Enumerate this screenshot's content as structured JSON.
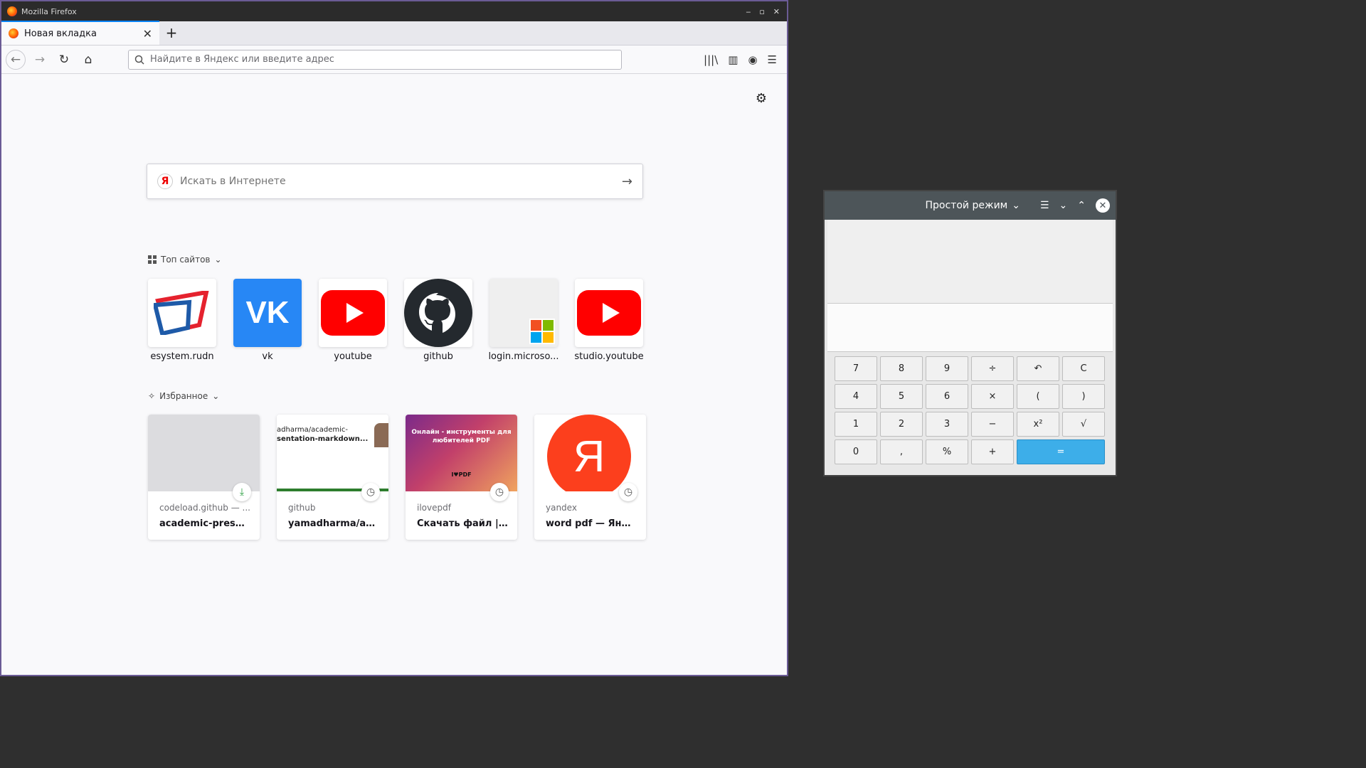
{
  "firefox": {
    "window_title": "Mozilla Firefox",
    "tab_title": "Новая вкладка",
    "url_placeholder": "Найдите в Яндекс или введите адрес",
    "search_placeholder": "Искать в Интернете",
    "top_sites_label": "Топ сайтов",
    "favorites_label": "Избранное",
    "top_sites": [
      {
        "label": "esystem.rudn",
        "icon": "esystem-logo"
      },
      {
        "label": "vk",
        "icon": "vk-logo",
        "color": "#2787f5"
      },
      {
        "label": "youtube",
        "icon": "youtube-logo",
        "color": "#ff0000"
      },
      {
        "label": "github",
        "icon": "github-logo",
        "color": "#24292e"
      },
      {
        "label": "login.microso...",
        "icon": "microsoft-logo"
      },
      {
        "label": "studio.youtube",
        "icon": "youtube-logo",
        "color": "#ff0000"
      }
    ],
    "highlights": [
      {
        "host": "codeload.github — ...",
        "title": "academic-presen...",
        "badge": "download-icon"
      },
      {
        "host": "github",
        "title": "yamadharma/aca...",
        "badge": "clock-icon",
        "thumb_line1": "adharma/academic-",
        "thumb_line2": "sentation-markdown..."
      },
      {
        "host": "ilovepdf",
        "title": "Скачать файл | iL...",
        "badge": "clock-icon",
        "thumb_line1": "Онлайн - инструменты для",
        "thumb_line2": "любителей PDF",
        "thumb_tag": "I♥PDF"
      },
      {
        "host": "yandex",
        "title": "word pdf — Янде...",
        "badge": "clock-icon",
        "thumb_letter": "Я"
      }
    ]
  },
  "calculator": {
    "mode_label": "Простой режим",
    "keys": {
      "r1": [
        "7",
        "8",
        "9",
        "÷",
        "↶",
        "C"
      ],
      "r2": [
        "4",
        "5",
        "6",
        "×",
        "(",
        ")"
      ],
      "r3": [
        "1",
        "2",
        "3",
        "−",
        "x²",
        "√"
      ],
      "r4": [
        "0",
        ",",
        "%",
        "+",
        "="
      ]
    }
  }
}
